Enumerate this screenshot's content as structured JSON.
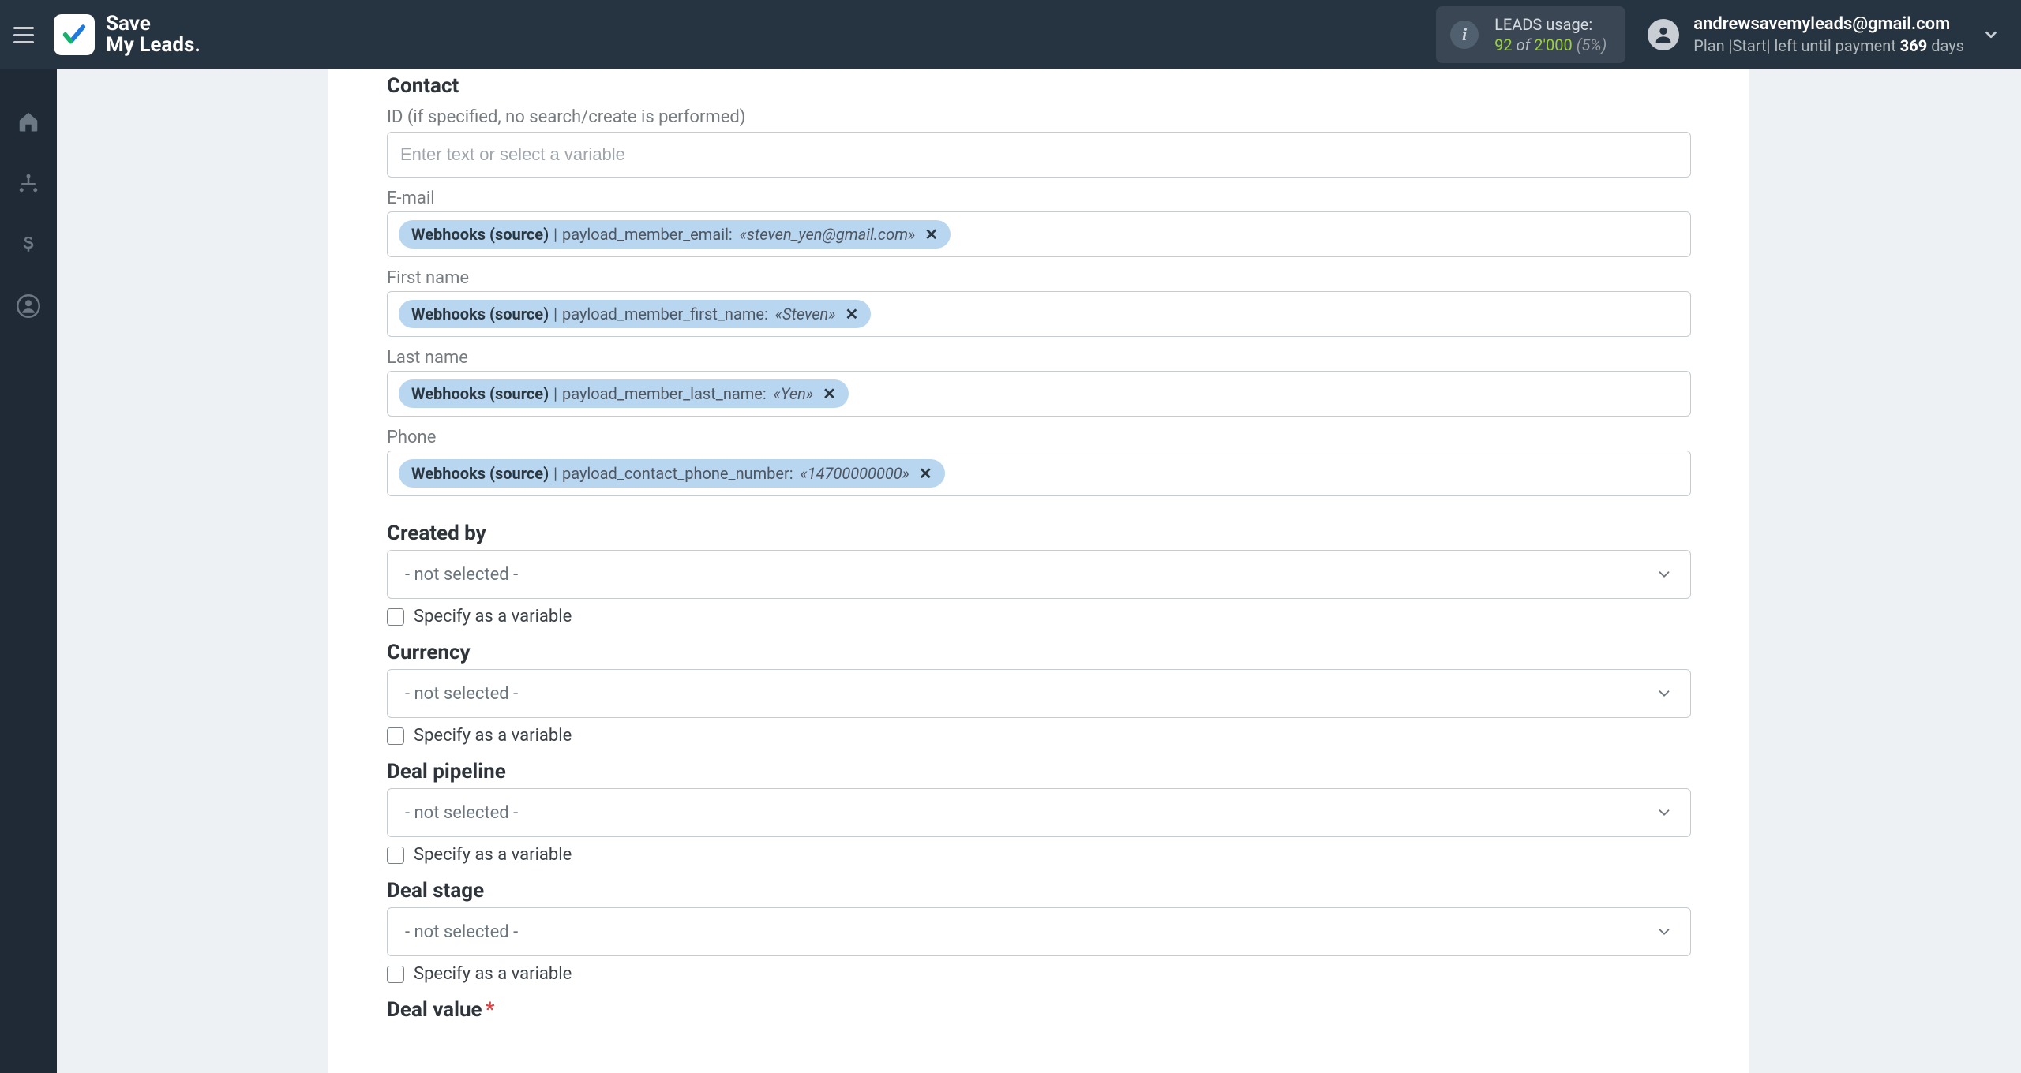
{
  "brand": {
    "line1": "Save",
    "line2": "My Leads."
  },
  "usage": {
    "title": "LEADS usage:",
    "current": "92",
    "of": "of",
    "max": "2'000",
    "percent": "(5%)"
  },
  "account": {
    "email": "andrewsavemyleads@gmail.com",
    "plan_prefix": "Plan |Start| left until payment ",
    "days": "369",
    "days_suffix": " days"
  },
  "placeholders": {
    "enter_var": "Enter text or select a variable"
  },
  "labels": {
    "contact": "Contact",
    "id_caption": "ID (if specified, no search/create is performed)",
    "email": "E-mail",
    "first_name": "First name",
    "last_name": "Last name",
    "phone": "Phone",
    "created_by": "Created by",
    "currency": "Currency",
    "deal_pipeline": "Deal pipeline",
    "deal_stage": "Deal stage",
    "deal_value": "Deal value",
    "specify_var": "Specify as a variable",
    "not_selected": "- not selected -"
  },
  "tokens": {
    "source": "Webhooks (source)",
    "email_key": "payload_member_email:",
    "email_val": "«steven_yen@gmail.com»",
    "first_key": "payload_member_first_name:",
    "first_val": "«Steven»",
    "last_key": "payload_member_last_name:",
    "last_val": "«Yen»",
    "phone_key": "payload_contact_phone_number:",
    "phone_val": "«14700000000»"
  }
}
